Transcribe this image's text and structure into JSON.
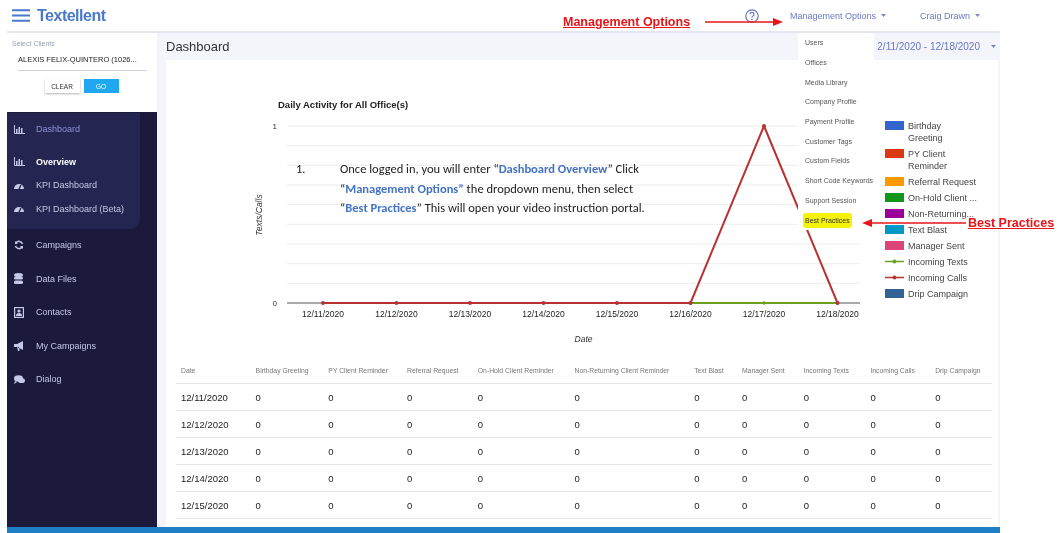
{
  "header": {
    "logo": "Textellent",
    "menus": [
      {
        "label": "Management Options"
      },
      {
        "label": "Craig Drawn"
      }
    ]
  },
  "client_select": {
    "label": "Select Clients",
    "value": "ALEXIS FELIX-QUINTERO (1026...",
    "buttons": [
      {
        "label": "CLEAR",
        "kind": "secondary"
      },
      {
        "label": "GO",
        "kind": "primary"
      }
    ]
  },
  "sidebar": {
    "items": [
      {
        "label": "Dashboard",
        "selected": false,
        "expanded": true,
        "children": [
          {
            "label": "Overview",
            "selected": true
          },
          {
            "label": "KPI Dashboard",
            "selected": false
          },
          {
            "label": "KPI Dashboard (Beta)",
            "selected": false
          }
        ]
      },
      {
        "label": "Campaigns",
        "selected": false
      },
      {
        "label": "Data Files",
        "selected": false
      },
      {
        "label": "Contacts",
        "selected": false
      },
      {
        "label": "My Campaigns",
        "selected": false
      },
      {
        "label": "Dialog",
        "selected": false
      }
    ]
  },
  "page_title": "Dashboard",
  "date_range": "2/11/2020 - 12/18/2020",
  "chart": {
    "chart_data": {
      "type": "line",
      "title": "Daily Activity for All Office(s)",
      "xlabel": "Date",
      "ylabel": "Texts/Calls",
      "categories": [
        "12/11/2020",
        "12/12/2020",
        "12/13/2020",
        "12/14/2020",
        "12/15/2020",
        "12/16/2020",
        "12/17/2020",
        "12/18/2020"
      ],
      "series": [
        {
          "name": "Incoming Texts",
          "color": "#6aa121",
          "values": [
            null,
            null,
            null,
            null,
            null,
            0,
            0,
            0
          ]
        },
        {
          "name": "Incoming Calls",
          "color": "#b83232",
          "values": [
            0,
            0,
            0,
            0,
            0,
            0,
            1,
            0
          ]
        }
      ],
      "ylim": [
        0,
        1
      ],
      "yticks": [
        0,
        1
      ]
    },
    "legend": [
      {
        "label": "Birthday Greeting",
        "color": "#3366cc",
        "kind": "box"
      },
      {
        "label": "PY Client Reminder",
        "color": "#dc3912",
        "kind": "box"
      },
      {
        "label": "Referral Request",
        "color": "#ff9900",
        "kind": "box"
      },
      {
        "label": "On-Hold Client ...",
        "color": "#109618",
        "kind": "box"
      },
      {
        "label": "Non-Returning...",
        "color": "#990099",
        "kind": "box"
      },
      {
        "label": "Text Blast",
        "color": "#0099c6",
        "kind": "box"
      },
      {
        "label": "Manager Sent",
        "color": "#dd4477",
        "kind": "box"
      },
      {
        "label": "Drip Campaign",
        "color": "#316395",
        "kind": "box"
      }
    ]
  },
  "table": {
    "columns": [
      "Date",
      "Birthday Greeting",
      "PY Client Reminder",
      "Referral Request",
      "On-Hold Client Reminder",
      "Non-Returning Client Reminder",
      "Text Blast",
      "Manager Sent",
      "Incoming Texts",
      "Incoming Calls",
      "Drip Campaign"
    ],
    "rows": [
      [
        "12/11/2020",
        "0",
        "0",
        "0",
        "0",
        "0",
        "0",
        "0",
        "0",
        "0",
        "0"
      ],
      [
        "12/12/2020",
        "0",
        "0",
        "0",
        "0",
        "0",
        "0",
        "0",
        "0",
        "0",
        "0"
      ],
      [
        "12/13/2020",
        "0",
        "0",
        "0",
        "0",
        "0",
        "0",
        "0",
        "0",
        "0",
        "0"
      ],
      [
        "12/14/2020",
        "0",
        "0",
        "0",
        "0",
        "0",
        "0",
        "0",
        "0",
        "0",
        "0"
      ],
      [
        "12/15/2020",
        "0",
        "0",
        "0",
        "0",
        "0",
        "0",
        "0",
        "0",
        "0",
        "0"
      ]
    ]
  },
  "management_menu": {
    "items": [
      {
        "label": "Users",
        "highlighted": false
      },
      {
        "label": "Offices",
        "highlighted": false
      },
      {
        "label": "Media Library",
        "highlighted": false
      },
      {
        "label": "Company Profile",
        "highlighted": false
      },
      {
        "label": "Payment Profile",
        "highlighted": false
      },
      {
        "label": "Customer Tags",
        "highlighted": false
      },
      {
        "label": "Custom Fields",
        "highlighted": false
      },
      {
        "label": "Short Code Keywords",
        "highlighted": false
      },
      {
        "label": "Support Session",
        "highlighted": false
      },
      {
        "label": "Best Practices",
        "highlighted": true
      }
    ]
  },
  "instruction": {
    "number": "1.",
    "lines": [
      "Once logged in, you will enter “**Dashboard Overview**” Click",
      "“**Management Options”** the dropdown menu, then select",
      "“**Best Practices**” This will open your video instruction portal."
    ]
  },
  "annotations": [
    {
      "text": "Management Options"
    },
    {
      "text": "Best Practices"
    }
  ]
}
